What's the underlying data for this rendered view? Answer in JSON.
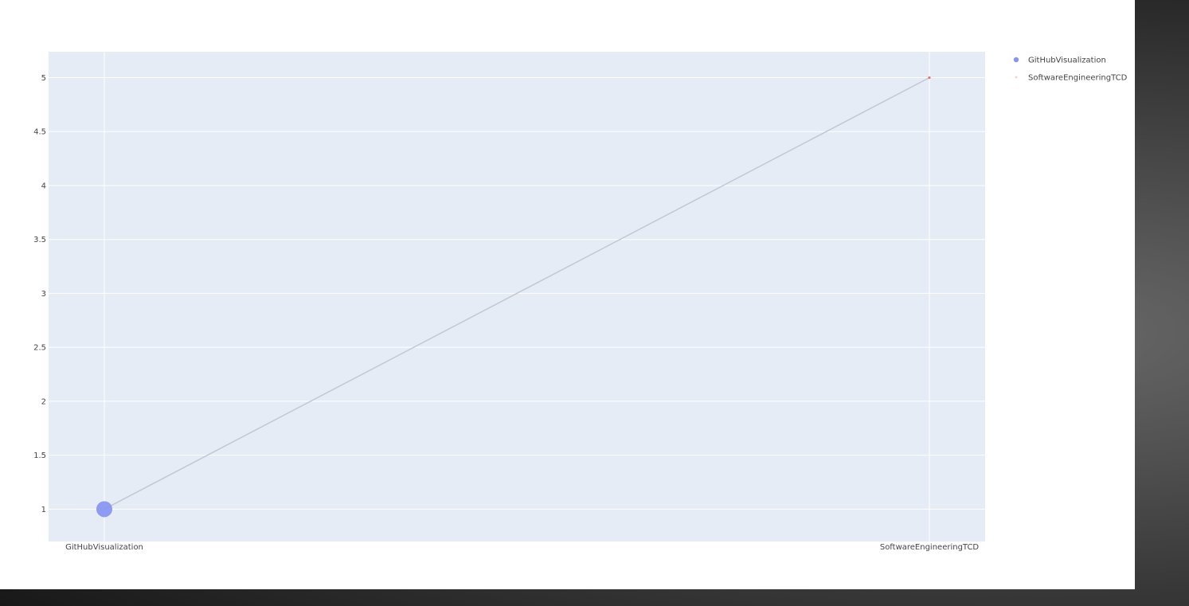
{
  "chart_data": {
    "type": "scatter",
    "categories": [
      "GitHubVisualization",
      "SoftwareEngineeringTCD"
    ],
    "ylim": [
      0.7,
      5.24
    ],
    "yticks": [
      1,
      1.5,
      2,
      2.5,
      3,
      3.5,
      4,
      4.5,
      5
    ],
    "grid": true,
    "legend_placement": "top-right",
    "connector": {
      "from": "GitHubVisualization",
      "to": "SoftwareEngineeringTCD",
      "color": "#c3c7d1"
    },
    "series": [
      {
        "name": "GitHubVisualization",
        "x": "GitHubVisualization",
        "y": 1,
        "marker_size": "large",
        "color": "#8794f2"
      },
      {
        "name": "SoftwareEngineeringTCD",
        "x": "SoftwareEngineeringTCD",
        "y": 5,
        "marker_size": "tiny",
        "color": "#ef6a5a"
      }
    ]
  },
  "colors": {
    "plot_background": "#e5ecf6",
    "gridline": "#ffffff",
    "tick_text": "#444444"
  }
}
